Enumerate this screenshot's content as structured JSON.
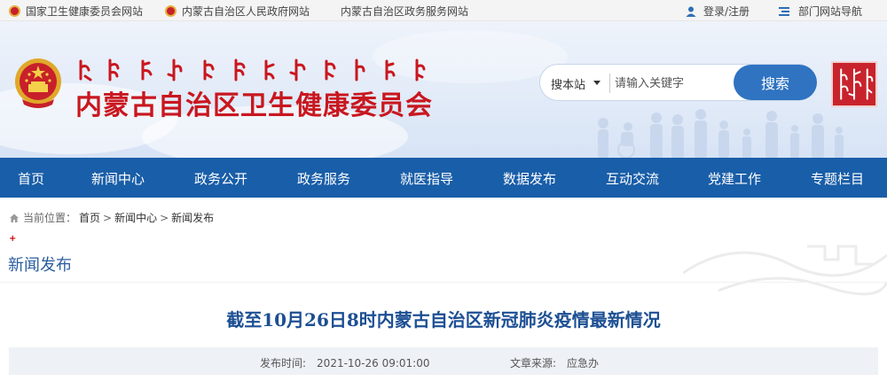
{
  "topbar": {
    "links": [
      "国家卫生健康委员会网站",
      "内蒙古自治区人民政府网站",
      "内蒙古自治区政务服务网站"
    ],
    "login": "登录/注册",
    "dept_nav": "部门网站导航"
  },
  "header": {
    "site_title": "内蒙古自治区卫生健康委员会",
    "search": {
      "scope": "搜本站",
      "placeholder": "请输入关键字",
      "button": "搜索"
    }
  },
  "nav": {
    "items": [
      "首页",
      "新闻中心",
      "政务公开",
      "政务服务",
      "就医指导",
      "数据发布",
      "互动交流",
      "党建工作",
      "专题栏目"
    ]
  },
  "breadcrumb": {
    "label": "当前位置：",
    "items": [
      "首页",
      "新闻中心",
      "新闻发布"
    ],
    "separator": ">"
  },
  "section": {
    "marker": "+",
    "title": "新闻发布"
  },
  "article": {
    "title": "截至10月26日8时内蒙古自治区新冠肺炎疫情最新情况",
    "publish_label": "发布时间:",
    "publish_time": "2021-10-26 09:01:00",
    "source_label": "文章来源:",
    "source": "应急办"
  },
  "colors": {
    "brand_red": "#c9171f",
    "nav_blue": "#195ea8",
    "search_blue": "#2f73c1",
    "title_blue": "#1c4f93"
  }
}
